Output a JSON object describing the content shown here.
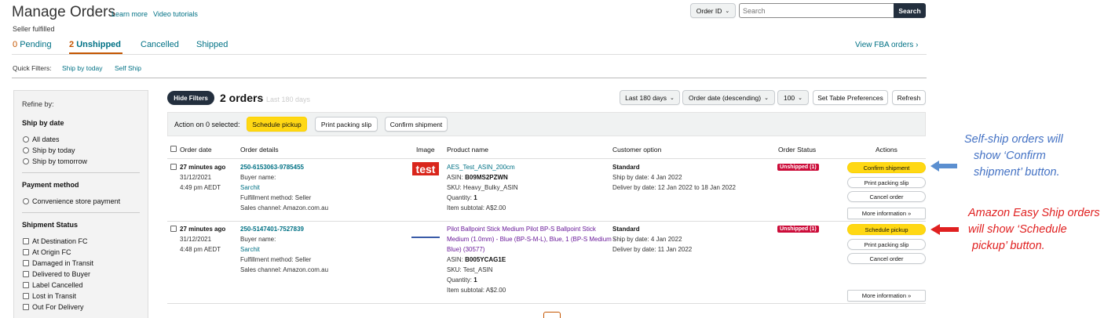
{
  "header": {
    "title": "Manage Orders",
    "learn_more": "Learn more",
    "video_tutorials": "Video tutorials",
    "subtitle": "Seller fulfilled",
    "search_type": "Order ID",
    "search_placeholder": "Search",
    "search_button": "Search"
  },
  "tabs": [
    {
      "count": "0",
      "label": "Pending"
    },
    {
      "count": "2",
      "label": "Unshipped"
    },
    {
      "label": "Cancelled"
    },
    {
      "label": "Shipped"
    }
  ],
  "view_fba": "View FBA orders ›",
  "quick_filters": {
    "label": "Quick Filters:",
    "items": [
      "Ship by today",
      "Self Ship"
    ]
  },
  "sidebar": {
    "refine": "Refine by:",
    "ship_by_date": {
      "title": "Ship by date",
      "options": [
        "All dates",
        "Ship by today",
        "Ship by tomorrow"
      ]
    },
    "payment": {
      "title": "Payment method",
      "options": [
        "Convenience store payment"
      ]
    },
    "shipment_status": {
      "title": "Shipment Status",
      "options": [
        "At Destination FC",
        "At Origin FC",
        "Damaged in Transit",
        "Delivered to Buyer",
        "Label Cancelled",
        "Lost in Transit",
        "Out For Delivery"
      ]
    }
  },
  "toolbar": {
    "hide_filters": "Hide Filters",
    "orders_count": "2 orders",
    "orders_period": "Last 180 days",
    "range_select": "Last 180 days",
    "sort_select": "Order date (descending)",
    "page_size": "100",
    "table_prefs": "Set Table Preferences",
    "refresh": "Refresh"
  },
  "action_bar": {
    "label": "Action on 0 selected:",
    "schedule_pickup": "Schedule pickup",
    "print_packing_slip": "Print packing slip",
    "confirm_shipment": "Confirm shipment"
  },
  "table": {
    "columns": [
      "Order date",
      "Order details",
      "Image",
      "Product name",
      "Customer option",
      "Order Status",
      "Actions"
    ],
    "rows": [
      {
        "time_ago": "27 minutes ago",
        "date": "31/12/2021",
        "time": "4:49 pm AEDT",
        "order_id": "250-6153063-9785455",
        "buyer_label": "Buyer name:",
        "buyer": "Sarchit",
        "fulfillment": "Fulfillment method: Seller",
        "channel": "Sales channel: Amazon.com.au",
        "image_text": "test",
        "product": "AES_Test_ASIN_200cm",
        "asin_label": "ASIN:",
        "asin": "B09MS2PZWN",
        "sku": "SKU: Heavy_Bulky_ASIN",
        "quantity_label": "Quantity:",
        "quantity": "1",
        "subtotal": "Item subtotal: A$2.00",
        "option": "Standard",
        "ship_by": "Ship by date: 4 Jan 2022",
        "deliver_by": "Deliver by date: 12 Jan 2022 to 18 Jan 2022",
        "status": "Unshipped (1)",
        "primary_action": "Confirm shipment",
        "print": "Print packing slip",
        "cancel": "Cancel order",
        "more": "More information »"
      },
      {
        "time_ago": "27 minutes ago",
        "date": "31/12/2021",
        "time": "4:48 pm AEDT",
        "order_id": "250-5147401-7527839",
        "buyer_label": "Buyer name:",
        "buyer": "Sarchit",
        "fulfillment": "Fulfillment method: Seller",
        "channel": "Sales channel: Amazon.com.au",
        "product_line1": "Pilot Ballpoint Stick Medium Pilot BP-S Ballpoint Stick",
        "product_line2": "Medium (1.0mm) - Blue (BP-S-M-L), Blue, 1 (BP-S Medium -",
        "product_line3": "Blue) (30577)",
        "asin_label": "ASIN:",
        "asin": "B005YCAG1E",
        "sku": "SKU: Test_ASIN",
        "quantity_label": "Quantity:",
        "quantity": "1",
        "subtotal": "Item subtotal: A$2.00",
        "option": "Standard",
        "ship_by": "Ship by date: 4 Jan 2022",
        "deliver_by": "Deliver by date: 11 Jan 2022",
        "status": "Unshipped (1)",
        "primary_action": "Schedule pickup",
        "print": "Print packing slip",
        "cancel": "Cancel order",
        "more": "More information »"
      }
    ]
  },
  "annotations": {
    "self_ship": [
      "Self-ship orders will",
      "show ‘Confirm",
      "shipment’ button."
    ],
    "easy_ship": [
      "Amazon Easy Ship orders",
      "will show ‘Schedule",
      "pickup’ button."
    ],
    "self_ship_color": "#4472c4",
    "easy_ship_color": "#e02020"
  },
  "colors": {
    "link": "#007185",
    "accent_orange": "#c45500",
    "yellow_button": "#ffd814",
    "status_red": "#cc0c39"
  }
}
